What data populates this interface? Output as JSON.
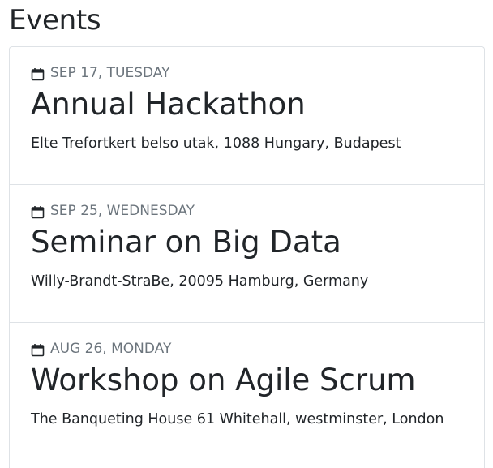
{
  "page": {
    "title": "Events"
  },
  "events": [
    {
      "date": "SEP 17, TUESDAY",
      "title": "Annual Hackathon",
      "location": "Elte Trefortkert belso utak, 1088 Hungary, Budapest",
      "icon": "calendar-icon"
    },
    {
      "date": "SEP 25, WEDNESDAY",
      "title": "Seminar on Big Data",
      "location": "Willy-Brandt-StraBe, 20095 Hamburg, Germany",
      "icon": "calendar-icon"
    },
    {
      "date": "AUG 26, MONDAY",
      "title": "Workshop on Agile Scrum",
      "location": "The Banqueting House 61 Whitehall, westminster, London",
      "icon": "calendar-icon"
    }
  ],
  "colors": {
    "text": "#212529",
    "muted": "#6c757d",
    "border": "#dee2e6"
  }
}
